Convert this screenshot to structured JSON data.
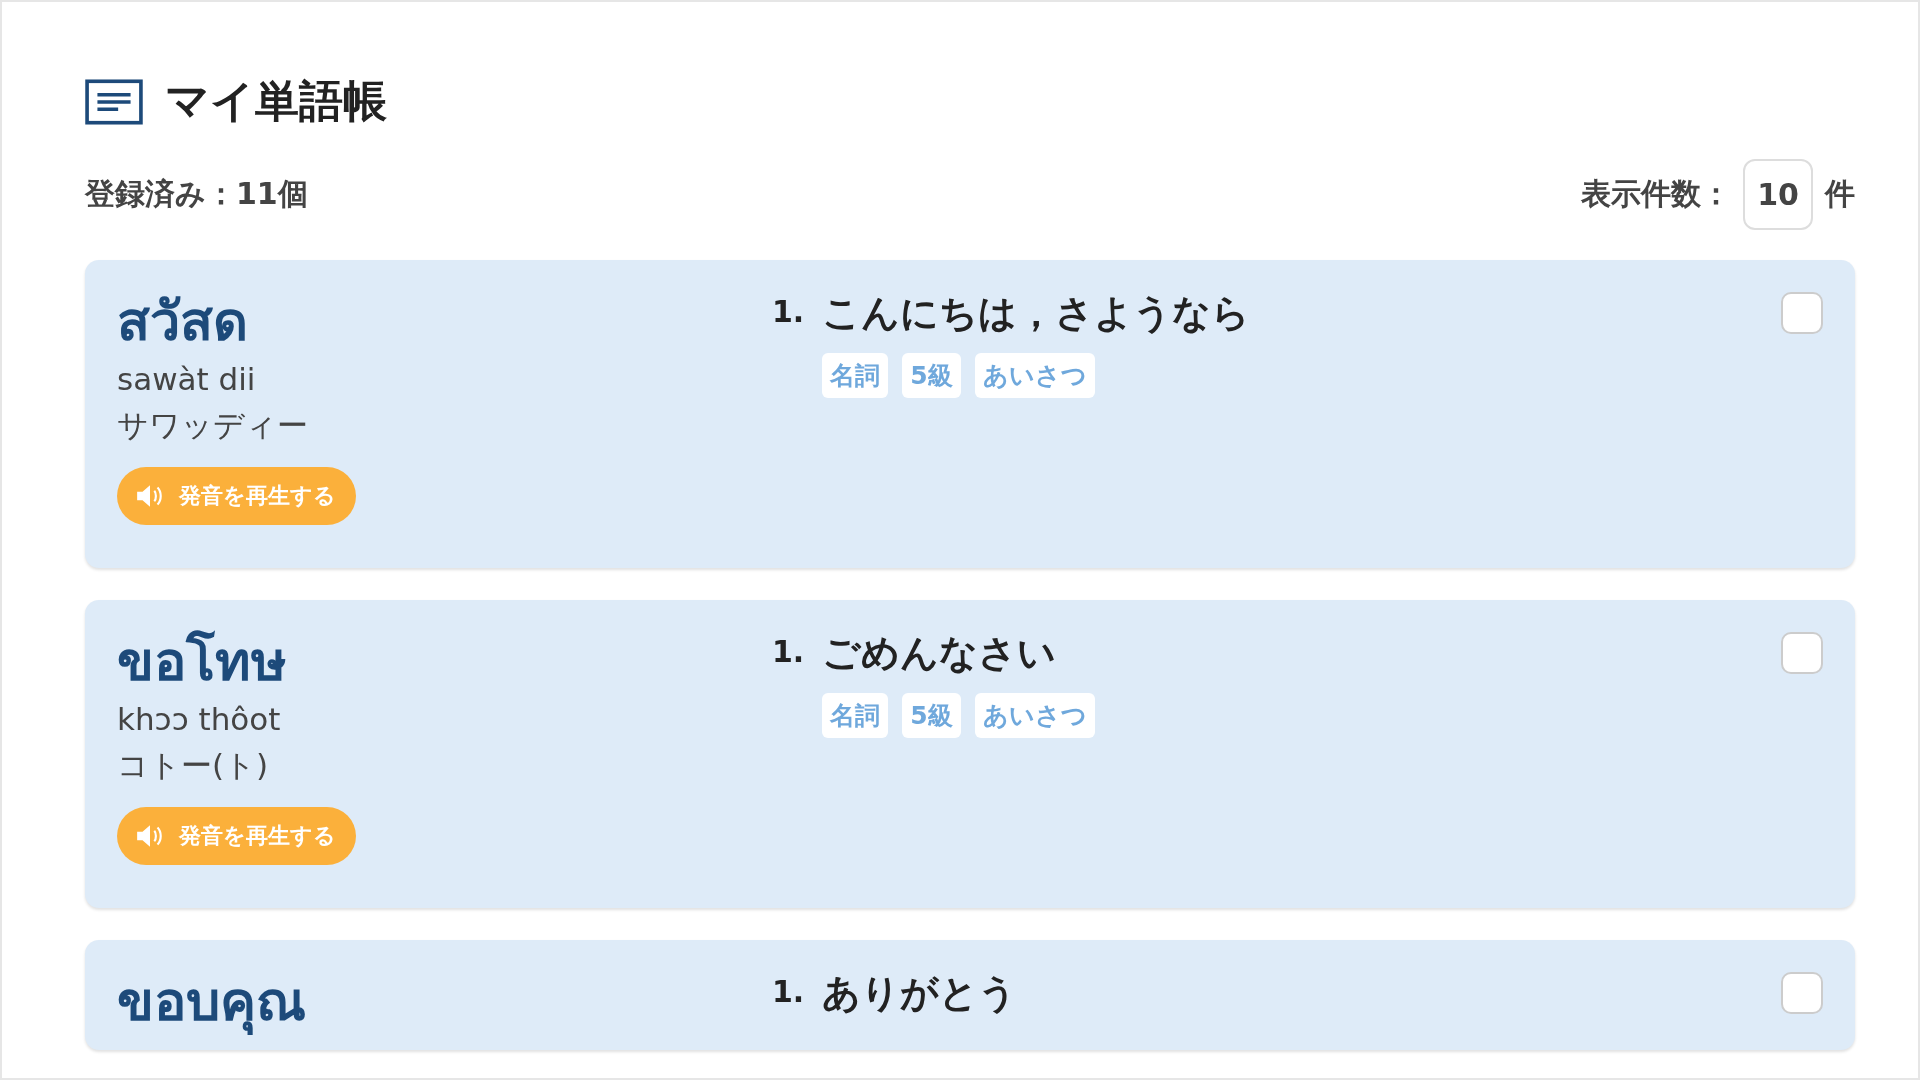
{
  "header": {
    "title": "マイ単語帳"
  },
  "summary": {
    "registered": "登録済み：11個",
    "per_page_label": "表示件数：",
    "per_page_value": "10",
    "per_page_unit": "件"
  },
  "words": [
    {
      "thai": "สวัสด",
      "romanization": "sawàt dii",
      "katakana": "サワッディー",
      "play_label": "発音を再生する",
      "checked": false,
      "meanings": [
        {
          "number": "1.",
          "text": "こんにちは，さようなら",
          "tags": [
            "名詞",
            "5級",
            "あいさつ"
          ]
        }
      ]
    },
    {
      "thai": "ขอโทษ",
      "romanization": "khɔɔ thôot",
      "katakana": "コトー(ト)",
      "play_label": "発音を再生する",
      "checked": false,
      "meanings": [
        {
          "number": "1.",
          "text": "ごめんなさい",
          "tags": [
            "名詞",
            "5級",
            "あいさつ"
          ]
        }
      ]
    },
    {
      "thai": "ขอบคุณ",
      "checked": false,
      "meanings": [
        {
          "number": "1.",
          "text": "ありがとう"
        }
      ]
    }
  ]
}
